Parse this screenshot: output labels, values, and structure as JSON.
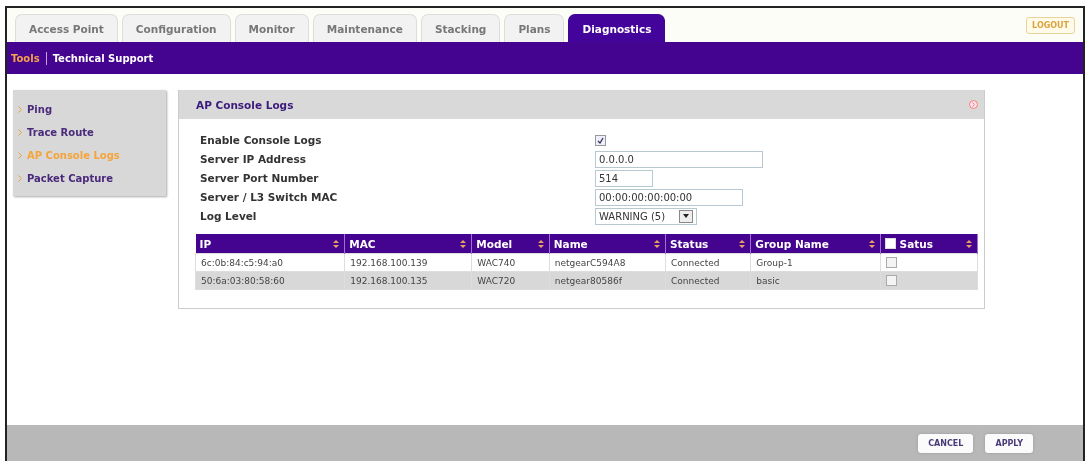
{
  "tabs": [
    {
      "label": "Access Point",
      "selected": false
    },
    {
      "label": "Configuration",
      "selected": false
    },
    {
      "label": "Monitor",
      "selected": false
    },
    {
      "label": "Maintenance",
      "selected": false
    },
    {
      "label": "Stacking",
      "selected": false
    },
    {
      "label": "Plans",
      "selected": false
    },
    {
      "label": "Diagnostics",
      "selected": true
    }
  ],
  "logout_button": "LOGOUT",
  "subnav": [
    {
      "label": "Tools",
      "selected": true
    },
    {
      "label": "Technical Support",
      "selected": false
    }
  ],
  "sidebar": {
    "items": [
      {
        "label": "Ping",
        "selected": false
      },
      {
        "label": "Trace Route",
        "selected": false
      },
      {
        "label": "AP Console Logs",
        "selected": true
      },
      {
        "label": "Packet Capture",
        "selected": false
      }
    ]
  },
  "panel": {
    "title": "AP Console Logs",
    "fields": [
      {
        "kind": "checkbox",
        "label": "Enable Console Logs",
        "checked": true
      },
      {
        "kind": "text",
        "label": "Server IP Address",
        "value": "0.0.0.0"
      },
      {
        "kind": "text",
        "label": "Server Port Number",
        "value": "514"
      },
      {
        "kind": "text",
        "label": "Server / L3 Switch MAC",
        "value": "00:00:00:00:00:00"
      },
      {
        "kind": "select",
        "label": "Log Level",
        "value": "WARNING (5)"
      }
    ],
    "table": {
      "columns": [
        {
          "label": "IP",
          "kind": "text"
        },
        {
          "label": "MAC",
          "kind": "text"
        },
        {
          "label": "Model",
          "kind": "text"
        },
        {
          "label": "Name",
          "kind": "text"
        },
        {
          "label": "Status",
          "kind": "text"
        },
        {
          "label": "Group Name",
          "kind": "text"
        },
        {
          "label": "Satus",
          "kind": "checkbox",
          "checked": false
        }
      ],
      "rows": [
        {
          "cells": [
            "6c:0b:84:c5:94:a0",
            "192.168.100.139",
            "WAC740",
            "netgearC594A8",
            "Connected",
            "Group-1"
          ],
          "checked": false
        },
        {
          "cells": [
            "50:6a:03:80:58:60",
            "192.168.100.135",
            "WAC720",
            "netgear80586f",
            "Connected",
            "basic"
          ],
          "checked": false
        }
      ]
    }
  },
  "buttons": [
    "CANCEL",
    "APPLY"
  ]
}
